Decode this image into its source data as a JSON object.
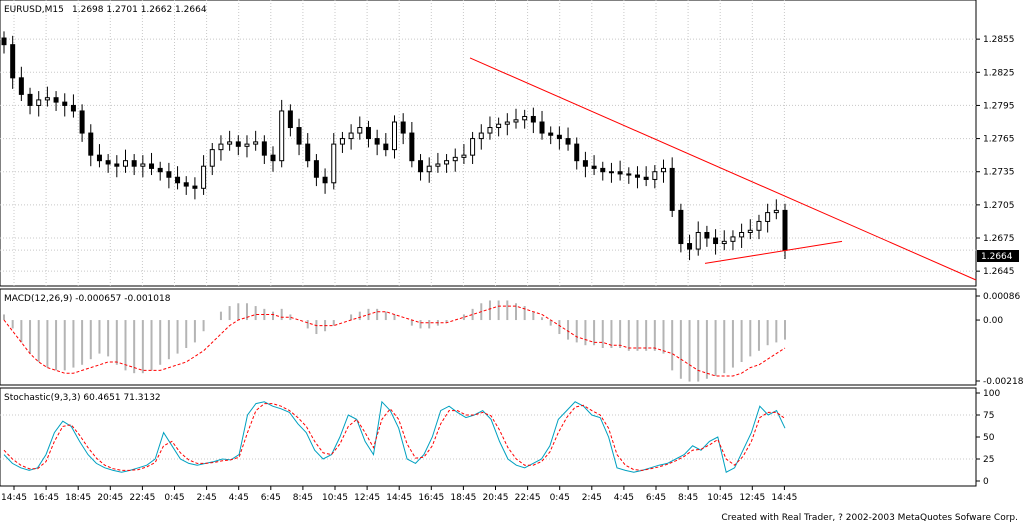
{
  "chart_data": [
    {
      "type": "candlestick",
      "title": "EURUSD,M15",
      "ohlc_header": "1.2698 1.2701 1.2662 1.2664",
      "current_price_label": "1.2664",
      "current_price": 1.2664,
      "y_ticks": [
        "1.2855",
        "1.2825",
        "1.2795",
        "1.2765",
        "1.2735",
        "1.2705",
        "1.2675",
        "1.2645"
      ],
      "ylim": [
        1.2637,
        1.2885
      ],
      "x_ticks": [
        "14:45",
        "16:45",
        "18:45",
        "20:45",
        "22:45",
        "0:45",
        "2:45",
        "4:45",
        "6:45",
        "8:45",
        "10:45",
        "12:45",
        "14:45",
        "16:45",
        "18:45",
        "20:45",
        "22:45",
        "0:45",
        "2:45",
        "4:45",
        "6:45",
        "8:45",
        "10:45",
        "12:45",
        "14:45"
      ],
      "close_series": [
        1.285,
        1.282,
        1.2805,
        1.2795,
        1.28,
        1.2802,
        1.2798,
        1.2795,
        1.279,
        1.277,
        1.275,
        1.2745,
        1.2742,
        1.274,
        1.2745,
        1.274,
        1.2742,
        1.2738,
        1.2735,
        1.273,
        1.2725,
        1.2722,
        1.272,
        1.274,
        1.2755,
        1.276,
        1.2762,
        1.2758,
        1.276,
        1.2762,
        1.275,
        1.2745,
        1.279,
        1.2775,
        1.276,
        1.2745,
        1.273,
        1.2725,
        1.276,
        1.2765,
        1.277,
        1.2775,
        1.2765,
        1.276,
        1.2755,
        1.278,
        1.277,
        1.2745,
        1.2735,
        1.274,
        1.2742,
        1.2745,
        1.2748,
        1.275,
        1.2765,
        1.277,
        1.2775,
        1.2778,
        1.278,
        1.2782,
        1.2785,
        1.278,
        1.277,
        1.2768,
        1.2765,
        1.276,
        1.2745,
        1.274,
        1.2738,
        1.2735,
        1.2735,
        1.2733,
        1.2732,
        1.273,
        1.2728,
        1.2735,
        1.2738,
        1.27,
        1.267,
        1.2665,
        1.268,
        1.2675,
        1.267,
        1.2672,
        1.2676,
        1.268,
        1.2682,
        1.269,
        1.2698,
        1.27,
        1.2664
      ],
      "trendlines": [
        {
          "color": "#ff0000",
          "from": {
            "x": "18:45",
            "y": 1.2838
          },
          "to": {
            "x": "16:45",
            "y": 1.2637
          }
        },
        {
          "color": "#ff0000",
          "from": {
            "x": "10:45",
            "y": 1.2652
          },
          "to": {
            "x": "16:45",
            "y": 1.2672
          }
        }
      ],
      "colors": {
        "candle": "#000000",
        "trendline": "#ff0000",
        "grid": "#c8c8c8"
      }
    },
    {
      "type": "bar",
      "title": "MACD(12,26,9) -0.000657 -0.001018",
      "y_ticks": [
        "0.00086",
        "0.00",
        "-0.00218"
      ],
      "ylim": [
        -0.00218,
        0.00086
      ],
      "histogram": [
        0.0002,
        -0.0003,
        -0.0008,
        -0.0012,
        -0.0015,
        -0.0017,
        -0.0018,
        -0.0018,
        -0.0017,
        -0.0016,
        -0.0014,
        -0.0012,
        -0.0013,
        -0.0016,
        -0.0018,
        -0.0019,
        -0.0019,
        -0.0018,
        -0.0016,
        -0.0014,
        -0.0012,
        -0.001,
        -0.0008,
        -0.0004,
        0.0,
        0.0003,
        0.0005,
        0.0006,
        0.0006,
        0.0005,
        0.0004,
        0.0003,
        0.0004,
        0.0002,
        0.0,
        -0.0003,
        -0.0005,
        -0.0004,
        -0.0002,
        0.0,
        0.0002,
        0.0003,
        0.0004,
        0.0004,
        0.0003,
        0.0002,
        0.0,
        -0.0002,
        -0.0003,
        -0.0003,
        -0.0002,
        -0.0001,
        0.0,
        0.0002,
        0.0004,
        0.0006,
        0.0007,
        0.0007,
        0.0007,
        0.0006,
        0.0005,
        0.0003,
        0.0001,
        -0.0002,
        -0.0005,
        -0.0007,
        -0.0008,
        -0.0009,
        -0.0009,
        -0.001,
        -0.001,
        -0.001,
        -0.0011,
        -0.0011,
        -0.0011,
        -0.0011,
        -0.0012,
        -0.0018,
        -0.0021,
        -0.0022,
        -0.0022,
        -0.0021,
        -0.002,
        -0.0019,
        -0.0017,
        -0.0015,
        -0.0013,
        -0.0011,
        -0.0009,
        -0.0008,
        -0.0007
      ],
      "signal": [
        0.0,
        -0.0004,
        -0.0008,
        -0.0012,
        -0.0015,
        -0.0017,
        -0.0018,
        -0.0019,
        -0.0019,
        -0.0018,
        -0.0017,
        -0.0016,
        -0.0015,
        -0.0015,
        -0.0016,
        -0.0017,
        -0.0018,
        -0.0018,
        -0.0018,
        -0.0017,
        -0.0016,
        -0.0015,
        -0.0013,
        -0.0011,
        -0.0008,
        -0.0005,
        -0.0002,
        0.0,
        0.0001,
        0.0002,
        0.0002,
        0.0002,
        0.0001,
        0.0001,
        0.0,
        -0.0001,
        -0.0002,
        -0.0002,
        -0.0002,
        -0.0001,
        0.0,
        0.0001,
        0.0002,
        0.0003,
        0.0003,
        0.0002,
        0.0001,
        0.0,
        -0.0001,
        -0.0001,
        -0.0001,
        -0.0001,
        0.0,
        0.0001,
        0.0002,
        0.0003,
        0.0004,
        0.0005,
        0.0005,
        0.0005,
        0.0004,
        0.0003,
        0.0002,
        0.0,
        -0.0002,
        -0.0004,
        -0.0006,
        -0.0007,
        -0.0008,
        -0.0008,
        -0.0009,
        -0.0009,
        -0.001,
        -0.001,
        -0.001,
        -0.001,
        -0.0011,
        -0.0012,
        -0.0014,
        -0.0016,
        -0.0018,
        -0.0019,
        -0.002,
        -0.002,
        -0.002,
        -0.0019,
        -0.0017,
        -0.0016,
        -0.0014,
        -0.0012,
        -0.001
      ],
      "colors": {
        "histogram": "#b4b4b4",
        "signal": "#ff0000"
      }
    },
    {
      "type": "line",
      "title": "Stochastic(9,3,3) 60.4651 71.3132",
      "y_ticks": [
        "100",
        "75",
        "50",
        "25",
        "0"
      ],
      "ylim": [
        0,
        100
      ],
      "series": [
        {
          "color": "#00a0c0",
          "values": [
            30,
            20,
            15,
            12,
            15,
            30,
            55,
            68,
            62,
            45,
            30,
            20,
            15,
            12,
            10,
            12,
            15,
            18,
            25,
            55,
            40,
            25,
            20,
            18,
            20,
            22,
            25,
            24,
            30,
            75,
            88,
            90,
            85,
            82,
            78,
            65,
            55,
            35,
            25,
            30,
            50,
            75,
            70,
            45,
            30,
            90,
            80,
            60,
            25,
            20,
            30,
            50,
            80,
            85,
            78,
            72,
            75,
            80,
            70,
            45,
            25,
            18,
            15,
            20,
            25,
            40,
            70,
            80,
            90,
            85,
            75,
            72,
            50,
            15,
            12,
            10,
            12,
            15,
            18,
            20,
            25,
            30,
            40,
            35,
            45,
            50,
            10,
            15,
            35,
            55,
            85,
            75,
            80,
            60
          ]
        },
        {
          "color": "#ff0000",
          "values": [
            35,
            25,
            18,
            14,
            14,
            22,
            45,
            62,
            64,
            52,
            38,
            26,
            18,
            14,
            12,
            12,
            13,
            16,
            21,
            40,
            45,
            32,
            24,
            20,
            20,
            21,
            23,
            24,
            27,
            55,
            80,
            88,
            88,
            85,
            80,
            72,
            62,
            45,
            32,
            30,
            42,
            62,
            70,
            55,
            38,
            70,
            82,
            70,
            42,
            26,
            27,
            40,
            65,
            80,
            80,
            75,
            75,
            78,
            74,
            58,
            38,
            25,
            18,
            18,
            22,
            33,
            55,
            72,
            84,
            86,
            80,
            75,
            60,
            30,
            18,
            13,
            12,
            14,
            16,
            19,
            23,
            28,
            35,
            36,
            41,
            47,
            25,
            18,
            28,
            45,
            72,
            78,
            78,
            71
          ]
        }
      ],
      "colors": {
        "k_line": "#00a0c0",
        "d_line": "#ff0000"
      }
    }
  ],
  "footer": {
    "credit": "Created with Real Trader, ? 2002-2003 MetaQuotes Sofware Corp."
  }
}
